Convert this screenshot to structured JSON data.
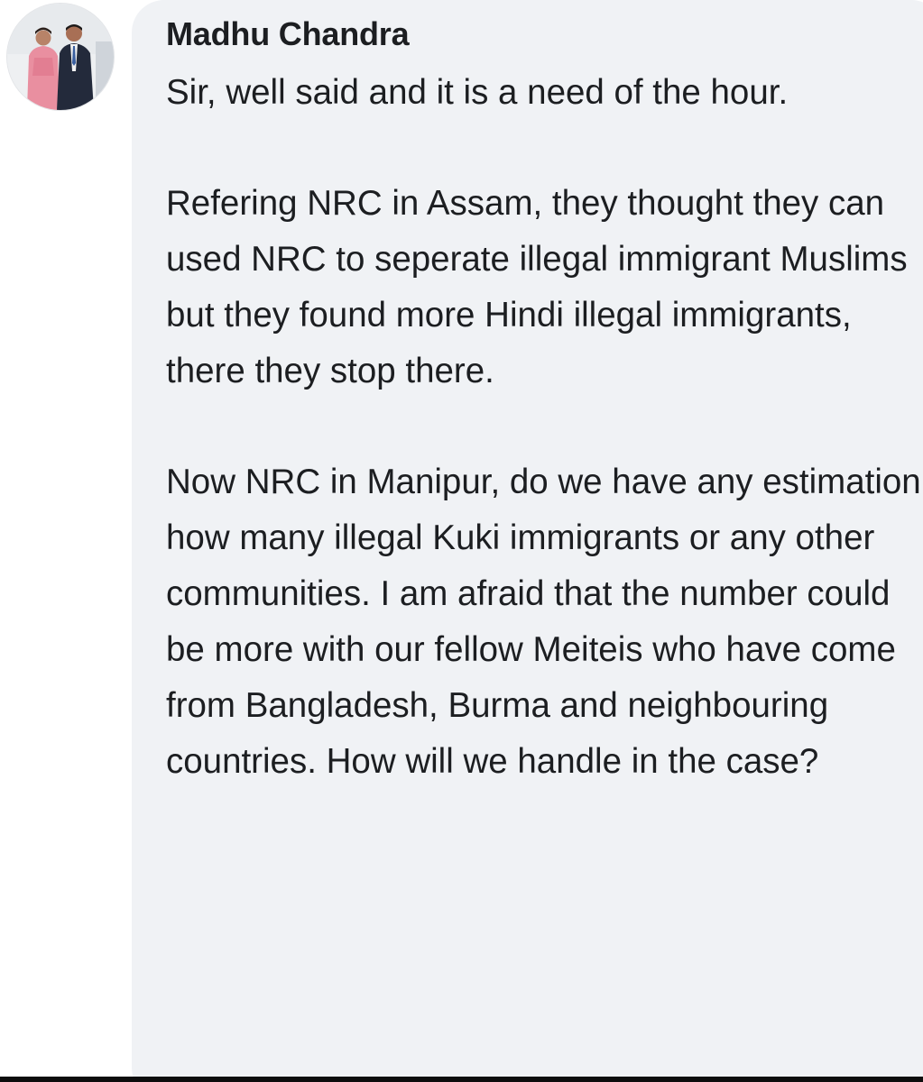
{
  "comment": {
    "author": "Madhu Chandra",
    "avatar_icon": "profile-photo-avatar",
    "paragraphs": [
      "Sir, well said and it is a need of the hour.",
      "Refering NRC in Assam, they thought they can used NRC to seperate illegal immigrant Muslims but they found more Hindi illegal immigrants, there they stop there.",
      "Now NRC in Manipur, do we have any estimation how many illegal Kuki immigrants or any other communities. I am afraid that the number could be more with our fellow Meiteis who have come from Bangladesh, Burma and neighbouring countries. How will we handle in the case?"
    ]
  },
  "colors": {
    "bubble_bg": "#f0f2f5",
    "text": "#1c1e21",
    "page_bg": "#ffffff"
  }
}
